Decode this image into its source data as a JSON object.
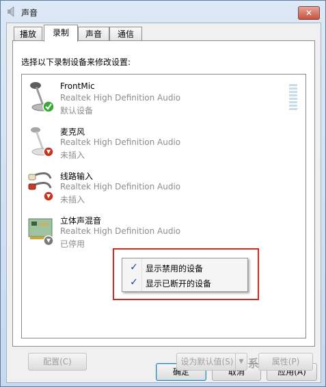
{
  "window": {
    "title": "声音",
    "close_label": "✕"
  },
  "tabs": [
    {
      "label": "播放",
      "active": false
    },
    {
      "label": "录制",
      "active": true
    },
    {
      "label": "声音",
      "active": false
    },
    {
      "label": "通信",
      "active": false
    }
  ],
  "panel": {
    "instruction": "选择以下录制设备来修改设置:"
  },
  "devices": [
    {
      "name": "FrontMic",
      "driver": "Realtek High Definition Audio",
      "status": "默认设备",
      "icon": "microphone-icon",
      "badge": "green-check"
    },
    {
      "name": "麦克风",
      "driver": "Realtek High Definition Audio",
      "status": "未插入",
      "icon": "microphone-icon",
      "badge": "red-down-arrow"
    },
    {
      "name": "线路输入",
      "driver": "Realtek High Definition Audio",
      "status": "未插入",
      "icon": "rca-cable-icon",
      "badge": "red-down-arrow"
    },
    {
      "name": "立体声混音",
      "driver": "Realtek High Definition Audio",
      "status": "已停用",
      "icon": "sound-card-icon",
      "badge": "gray-down-arrow"
    }
  ],
  "context_menu": {
    "items": [
      {
        "label": "显示禁用的设备",
        "checked": true
      },
      {
        "label": "显示已断开的设备",
        "checked": true
      }
    ]
  },
  "buttons": {
    "configure": "配置(C)",
    "set_default": "设为默认值(S)",
    "properties": "属性(P)",
    "ok": "确定",
    "cancel": "取消",
    "apply": "应用(A)"
  },
  "colors": {
    "highlight": "#e2231a",
    "status_ok": "#3aa935",
    "status_unplugged": "#c8341e"
  }
}
